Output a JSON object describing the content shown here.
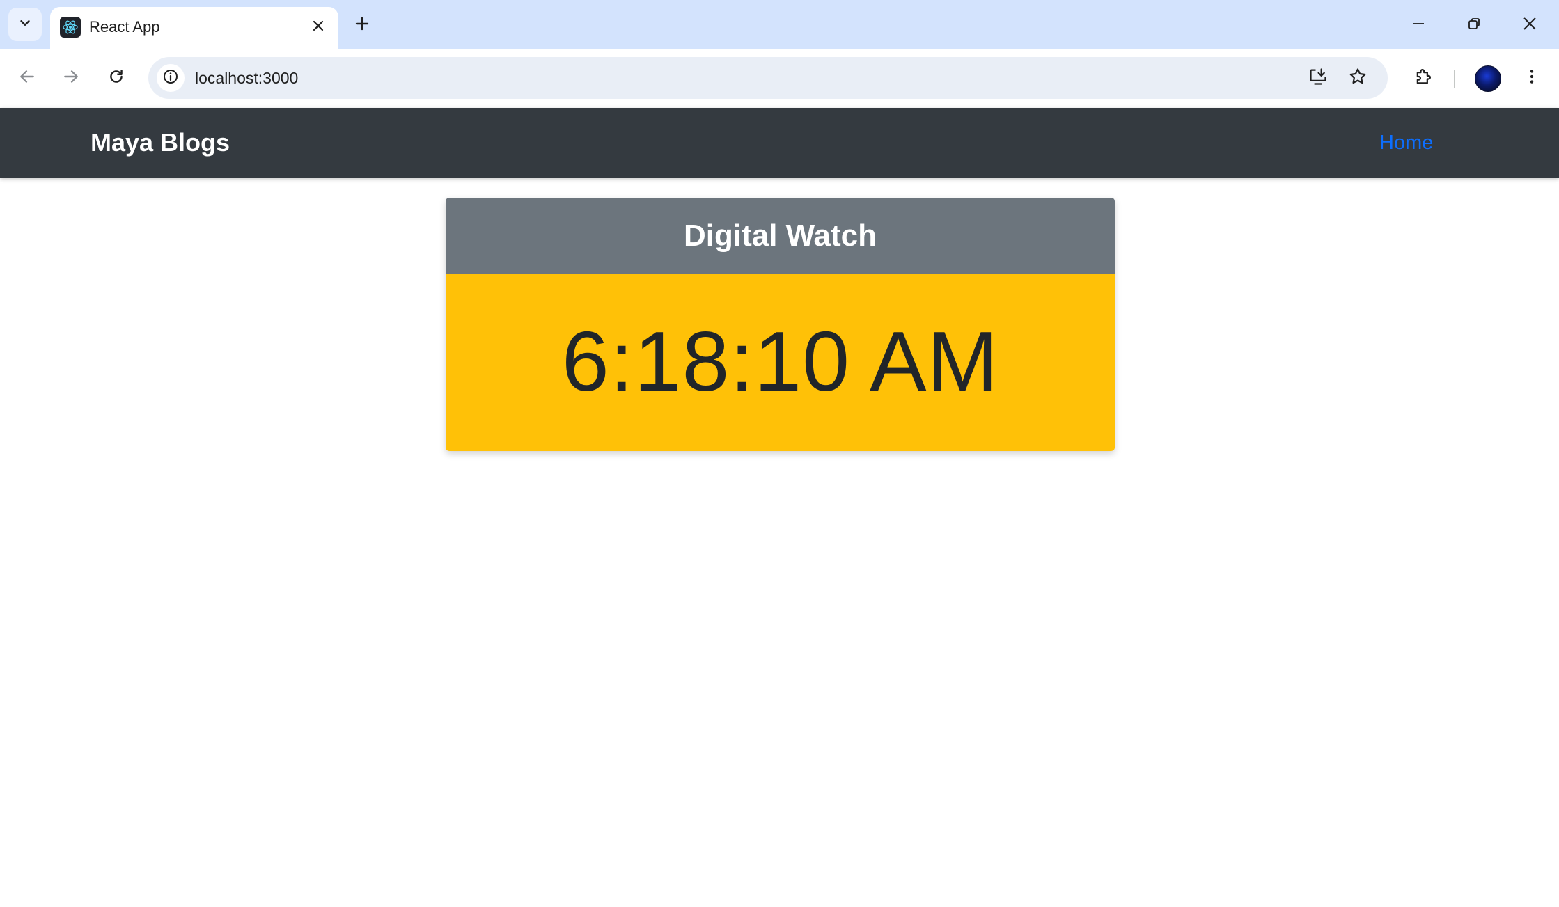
{
  "browser": {
    "tab": {
      "title": "React App",
      "favicon": "react-logo-icon"
    },
    "address_bar": {
      "url": "localhost:3000"
    },
    "icons": {
      "tab_search": "chevron-down-icon",
      "tab_close": "close-icon",
      "new_tab": "plus-icon",
      "minimize": "minimize-icon",
      "restore": "restore-icon",
      "close_window": "close-icon",
      "back": "arrow-left-icon",
      "forward": "arrow-right-icon",
      "reload": "reload-icon",
      "site_info": "info-icon",
      "install": "install-app-icon",
      "bookmark": "star-icon",
      "extensions": "puzzle-icon",
      "menu": "more-vertical-icon"
    },
    "colors": {
      "tabstrip": "#d3e3fd",
      "omnibox": "#e9eef6"
    }
  },
  "app": {
    "navbar": {
      "brand": "Maya Blogs",
      "links": [
        {
          "label": "Home"
        }
      ]
    },
    "watch": {
      "title": "Digital Watch",
      "time": "6:18:10 AM"
    },
    "colors": {
      "navbar_bg": "#343a40",
      "card_header_bg": "#6c757d",
      "card_body_bg": "#ffc107",
      "link": "#0d6efd"
    }
  }
}
